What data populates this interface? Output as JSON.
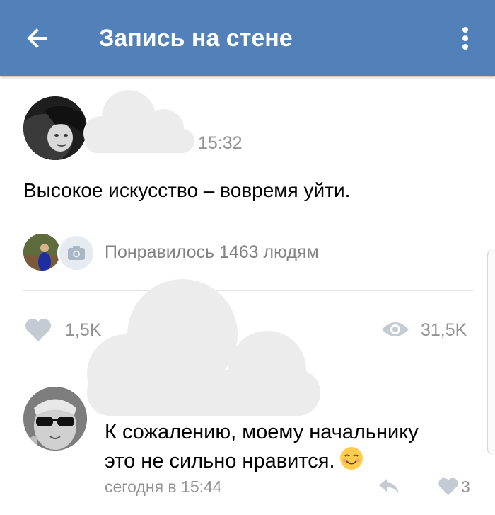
{
  "header": {
    "title": "Запись на стене",
    "back_icon": "arrow-left-icon",
    "menu_icon": "more-vertical-icon",
    "background_color": "#5181b8"
  },
  "post": {
    "time": "15:32",
    "text": "Высокое искусство – вовремя уйти.",
    "liked_by": "Понравилось 1463 людям",
    "likes": "1,5K",
    "views": "31,5K"
  },
  "comment": {
    "line1": "К сожалению, моему начальнику",
    "line2": "это не сильно нравится.",
    "emoji": "smiling-face-emoji",
    "date": "сегодня в 15:44",
    "likes": "3"
  },
  "colors": {
    "accent": "#5181b8",
    "secondary_text": "#939393",
    "icon_gray": "#c5cbd2"
  }
}
